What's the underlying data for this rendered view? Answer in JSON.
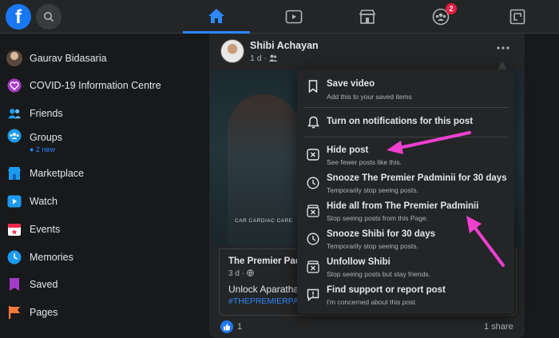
{
  "colors": {
    "accent": "#1877f2",
    "link": "#2d88ff",
    "badge": "#e41e3f",
    "arrow": "#ee3fd0"
  },
  "topbar": {
    "logo": "f",
    "notifications_badge": "2",
    "icons": [
      "facebook-logo",
      "search-icon",
      "home-icon",
      "watch-icon",
      "marketplace-icon",
      "groups-icon",
      "gaming-icon"
    ]
  },
  "sidebar": {
    "items": [
      {
        "label": "Gaurav Bidasaria",
        "icon": "avatar"
      },
      {
        "label": "COVID-19 Information Centre",
        "icon": "covid-heart-icon"
      },
      {
        "label": "Friends",
        "icon": "friends-icon"
      },
      {
        "label": "Groups",
        "sub": "● 2 new",
        "icon": "groups-icon"
      },
      {
        "label": "Marketplace",
        "icon": "marketplace-icon"
      },
      {
        "label": "Watch",
        "icon": "watch-icon"
      },
      {
        "label": "Events",
        "icon": "events-icon"
      },
      {
        "label": "Memories",
        "icon": "memories-icon"
      },
      {
        "label": "Saved",
        "icon": "saved-icon"
      },
      {
        "label": "Pages",
        "icon": "pages-icon"
      }
    ]
  },
  "post": {
    "author": "Shibi Achayan",
    "time": "1 d · ",
    "media_caption": "CAR CARDIAC CARE",
    "card": {
      "title": "The Premier Pad",
      "time": "3 d · ",
      "text": "Unlock Aparatha",
      "tag": "#THEPREMIERPA"
    },
    "likes": "1",
    "shares": "1 share"
  },
  "menu": {
    "items": [
      {
        "title": "Save video",
        "sub": "Add this to your saved items",
        "icon": "bookmark-icon"
      },
      {
        "title": "Turn on notifications for this post",
        "sub": "",
        "icon": "bell-icon"
      },
      {
        "title": "Hide post",
        "sub": "See fewer posts like this.",
        "icon": "hide-box-icon"
      },
      {
        "title": "Snooze The Premier Padminii for 30 days",
        "sub": "Temporarily stop seeing posts.",
        "icon": "clock-icon"
      },
      {
        "title": "Hide all from The Premier Padminii",
        "sub": "Stop seeing posts from this Page.",
        "icon": "hide-all-icon"
      },
      {
        "title": "Snooze Shibi for 30 days",
        "sub": "Temporarily stop seeing posts.",
        "icon": "clock-icon"
      },
      {
        "title": "Unfollow Shibi",
        "sub": "Stop seeing posts but stay friends.",
        "icon": "unfollow-icon"
      },
      {
        "title": "Find support or report post",
        "sub": "I'm concerned about this post.",
        "icon": "report-icon"
      }
    ]
  }
}
